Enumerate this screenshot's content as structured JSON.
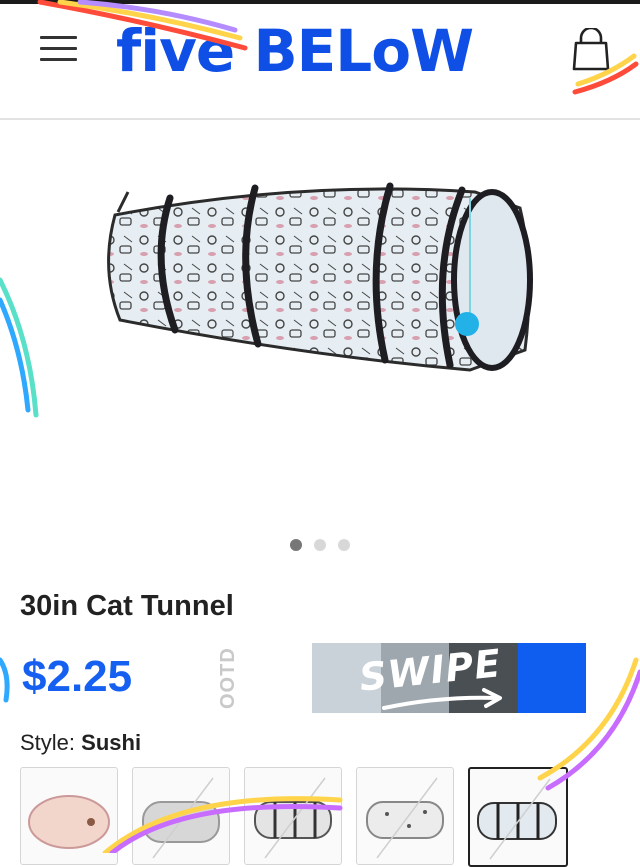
{
  "header": {
    "brand": "five BELoW",
    "menu_icon": "hamburger-icon",
    "cart_icon": "shopping-bag-icon"
  },
  "gallery": {
    "active_index": 0,
    "count": 3
  },
  "product": {
    "title": "30in Cat Tunnel",
    "price": "$2.25",
    "style_label": "Style:",
    "style_value": "Sushi"
  },
  "ootd": {
    "label": "OOTD",
    "swipe_text": "SWIPE",
    "colors": [
      "#ffffff",
      "#c9d2d8",
      "#9ea7ad",
      "#4a4f54",
      "#0f5ef0"
    ]
  },
  "styles": [
    "Pink",
    "Gray",
    "Gray Stripe",
    "Paw",
    "Sushi"
  ],
  "colors": {
    "brand_blue": "#0f4fe6",
    "price_blue": "#1560f0"
  }
}
